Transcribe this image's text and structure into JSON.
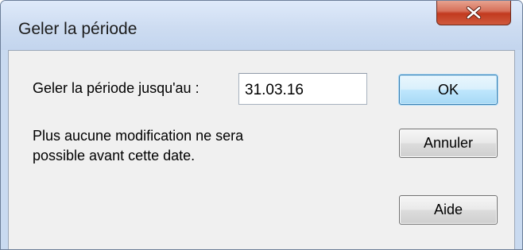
{
  "window": {
    "title": "Geler la période"
  },
  "form": {
    "freeze_label": "Geler la période jusqu'au :",
    "date_value": "31.03.16",
    "info_line1": "Plus aucune modification ne sera",
    "info_line2": "possible avant cette date."
  },
  "buttons": {
    "ok": "OK",
    "cancel": "Annuler",
    "help": "Aide"
  },
  "icons": {
    "close": "close-icon"
  },
  "colors": {
    "titlebar": "#cddcf1",
    "client": "#f0f0f0",
    "close_button": "#c23a1f",
    "default_button_border": "#3c7fb1"
  }
}
